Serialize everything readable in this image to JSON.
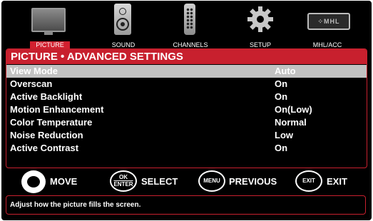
{
  "nav": {
    "items": [
      {
        "label": "PICTURE",
        "icon": "monitor-icon",
        "active": true
      },
      {
        "label": "SOUND",
        "icon": "speaker-icon",
        "active": false
      },
      {
        "label": "CHANNELS",
        "icon": "remote-icon",
        "active": false
      },
      {
        "label": "SETUP",
        "icon": "gear-icon",
        "active": false
      },
      {
        "label": "MHL/ACC",
        "icon": "mhl-icon",
        "active": false
      }
    ],
    "mhl_logo_text": "⁘MHL"
  },
  "panel": {
    "title": "PICTURE • ADVANCED SETTINGS",
    "rows": [
      {
        "label": "View Mode",
        "value": "Auto"
      },
      {
        "label": "Overscan",
        "value": "On"
      },
      {
        "label": "Active Backlight",
        "value": "On"
      },
      {
        "label": "Motion Enhancement",
        "value": "On(Low)"
      },
      {
        "label": "Color Temperature",
        "value": "Normal"
      },
      {
        "label": "Noise Reduction",
        "value": "Low"
      },
      {
        "label": "Active Contrast",
        "value": "On"
      }
    ],
    "selected_index": 0
  },
  "legend": {
    "move": "MOVE",
    "select": "SELECT",
    "select_key_top": "OK",
    "select_key_bottom": "ENTER",
    "previous": "PREVIOUS",
    "previous_key": "MENU",
    "exit": "EXIT",
    "exit_key": "EXIT"
  },
  "help": {
    "text": "Adjust how the picture fills the screen."
  },
  "colors": {
    "accent": "#c8202e",
    "selected_row": "#c2c2c2",
    "background": "#000000"
  }
}
